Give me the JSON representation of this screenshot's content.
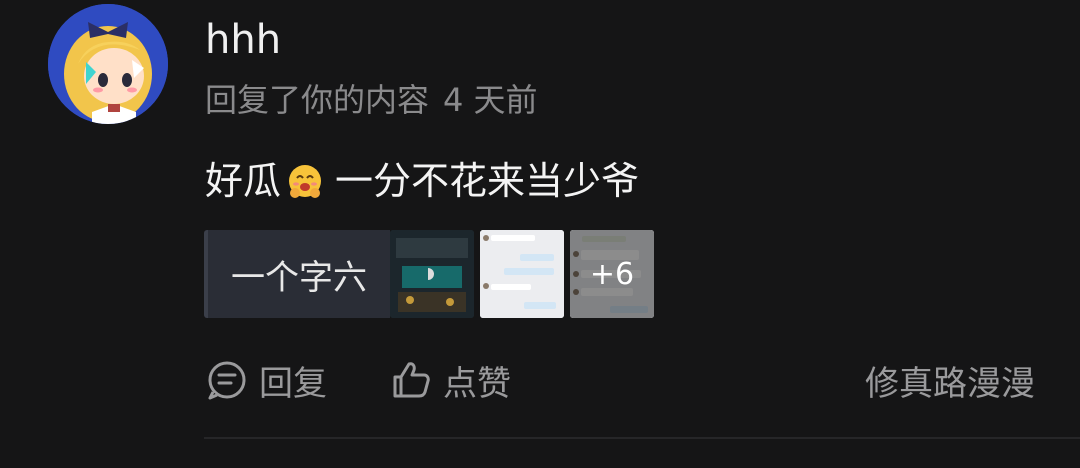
{
  "post": {
    "username": "hhh",
    "meta_action": "回复了你的内容",
    "meta_time": "4 天前",
    "comment_text_before": "好瓜",
    "comment_emoji_icon": "smiling-face-emoji-icon",
    "comment_text_after": "一分不花来当少爷"
  },
  "attachments": {
    "tag_label": "一个字六",
    "more_count": "+6"
  },
  "actions": {
    "reply_label": "回复",
    "like_label": "点赞",
    "nickname": "修真路漫漫"
  },
  "colors": {
    "background": "#151516",
    "secondary_text": "#8a8a8c",
    "avatar_bg": "#2f4bc1"
  }
}
